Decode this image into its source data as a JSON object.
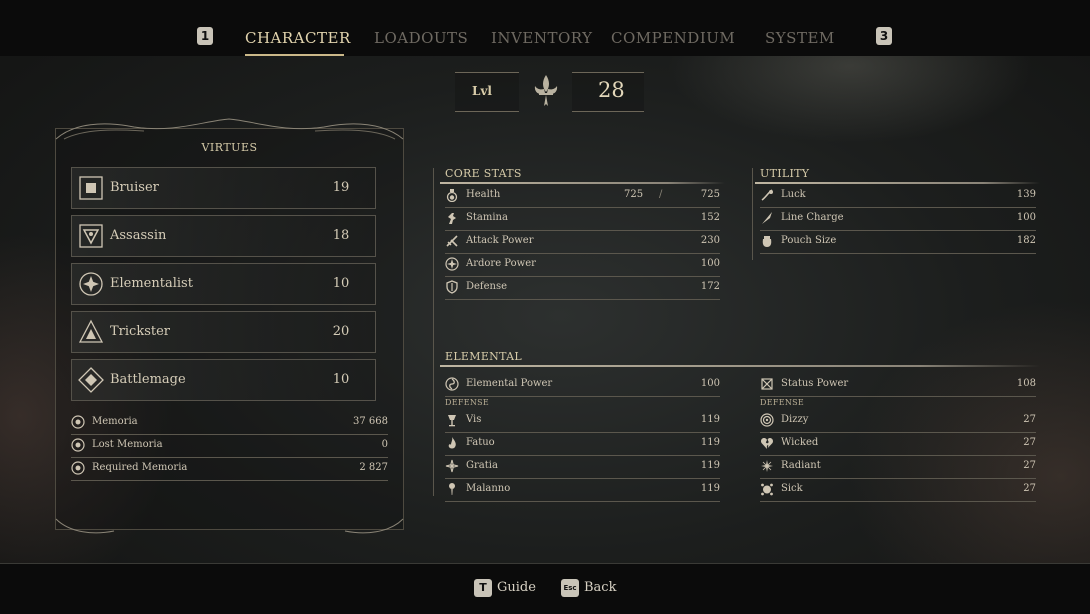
{
  "nav": {
    "left_key": "1",
    "right_key": "3",
    "tabs": [
      {
        "label": "CHARACTER",
        "active": true
      },
      {
        "label": "LOADOUTS",
        "active": false
      },
      {
        "label": "INVENTORY",
        "active": false
      },
      {
        "label": "COMPENDIUM",
        "active": false
      },
      {
        "label": "SYSTEM",
        "active": false
      }
    ]
  },
  "level": {
    "label": "Lvl",
    "value": "28"
  },
  "virtues": {
    "title": "VIRTUES",
    "items": [
      {
        "name": "Bruiser",
        "value": "19",
        "icon": "bruiser-icon"
      },
      {
        "name": "Assassin",
        "value": "18",
        "icon": "assassin-icon"
      },
      {
        "name": "Elementalist",
        "value": "10",
        "icon": "elementalist-icon"
      },
      {
        "name": "Trickster",
        "value": "20",
        "icon": "trickster-icon"
      },
      {
        "name": "Battlemage",
        "value": "10",
        "icon": "battlemage-icon"
      }
    ],
    "memoria": [
      {
        "name": "Memoria",
        "value": "37 668"
      },
      {
        "name": "Lost Memoria",
        "value": "0"
      },
      {
        "name": "Required Memoria",
        "value": "2 827"
      }
    ]
  },
  "core_stats": {
    "title": "CORE STATS",
    "items": [
      {
        "name": "Health",
        "current": "725",
        "separator": "/",
        "value": "725",
        "icon": "health-flask-icon"
      },
      {
        "name": "Stamina",
        "value": "152",
        "icon": "stamina-icon"
      },
      {
        "name": "Attack Power",
        "value": "230",
        "icon": "attack-power-icon"
      },
      {
        "name": "Ardore Power",
        "value": "100",
        "icon": "ardore-power-icon"
      },
      {
        "name": "Defense",
        "value": "172",
        "icon": "defense-shield-icon"
      }
    ]
  },
  "utility": {
    "title": "UTILITY",
    "items": [
      {
        "name": "Luck",
        "value": "139",
        "icon": "luck-icon"
      },
      {
        "name": "Line Charge",
        "value": "100",
        "icon": "line-charge-icon"
      },
      {
        "name": "Pouch Size",
        "value": "182",
        "icon": "pouch-icon"
      }
    ]
  },
  "elemental": {
    "title": "ELEMENTAL",
    "power": {
      "name": "Elemental Power",
      "value": "100",
      "icon": "elemental-power-icon"
    },
    "status_power": {
      "name": "Status Power",
      "value": "108",
      "icon": "status-power-icon"
    },
    "defense_label_left": "DEFENSE",
    "defense_label_right": "DEFENSE",
    "left_defense": [
      {
        "name": "Vis",
        "value": "119",
        "icon": "vis-icon"
      },
      {
        "name": "Fatuo",
        "value": "119",
        "icon": "fatuo-flame-icon"
      },
      {
        "name": "Gratia",
        "value": "119",
        "icon": "gratia-icon"
      },
      {
        "name": "Malanno",
        "value": "119",
        "icon": "malanno-icon"
      }
    ],
    "right_defense": [
      {
        "name": "Dizzy",
        "value": "27",
        "icon": "dizzy-spiral-icon"
      },
      {
        "name": "Wicked",
        "value": "27",
        "icon": "wicked-broken-heart-icon"
      },
      {
        "name": "Radiant",
        "value": "27",
        "icon": "radiant-star-icon"
      },
      {
        "name": "Sick",
        "value": "27",
        "icon": "sick-icon"
      }
    ]
  },
  "footer": {
    "guide_key": "T",
    "guide_label": "Guide",
    "back_key": "Esc",
    "back_label": "Back"
  },
  "colors": {
    "accent": "#e2d4ae",
    "rule": "#bfb6a2",
    "background": "#1c1e1d"
  }
}
